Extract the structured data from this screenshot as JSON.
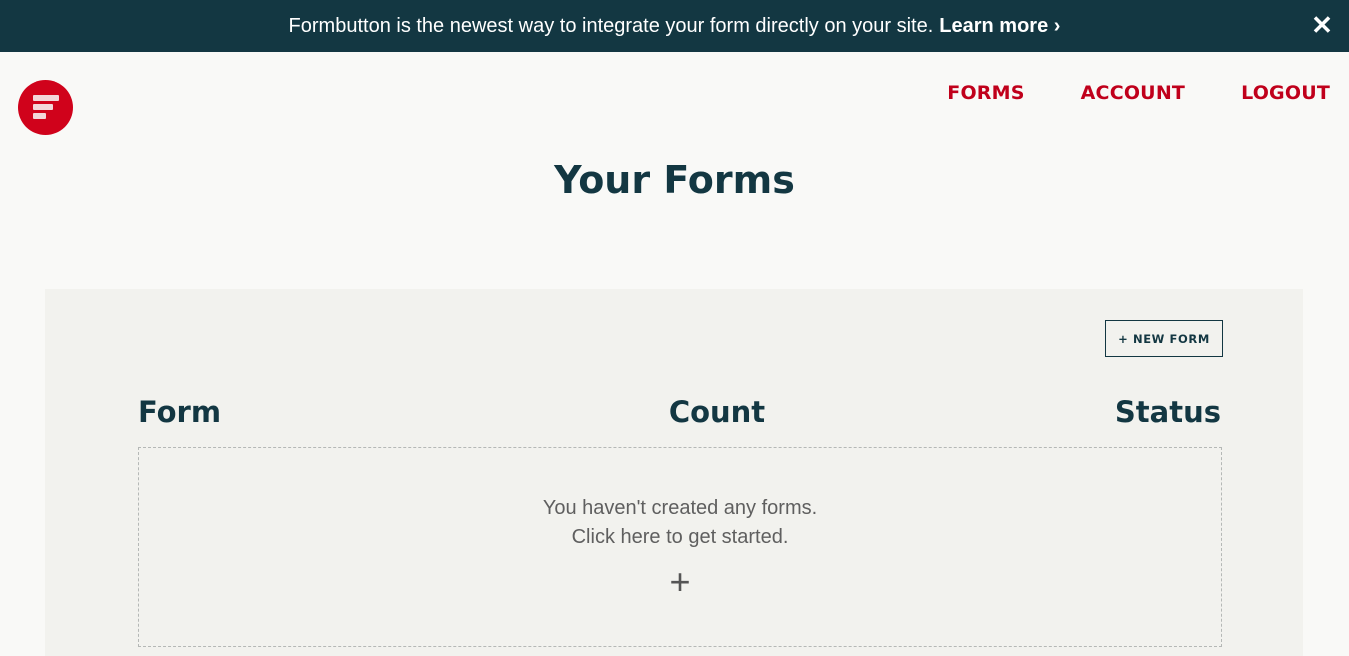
{
  "banner": {
    "message": "Formbutton is the newest way to integrate your form directly on your site.",
    "link_label": "Learn more ›",
    "close_glyph": "✕"
  },
  "nav": {
    "items": [
      {
        "label": "FORMS"
      },
      {
        "label": "ACCOUNT"
      },
      {
        "label": "LOGOUT"
      }
    ]
  },
  "page": {
    "title": "Your Forms"
  },
  "panel": {
    "new_form_label": "+ NEW FORM",
    "columns": [
      "Form",
      "Count",
      "Status"
    ],
    "empty_state": {
      "line1": "You haven't created any forms.",
      "line2": "Click here to get started.",
      "plus_glyph": "+"
    }
  },
  "colors": {
    "banner_bg": "#133742",
    "brand_red": "#d0021b",
    "nav_red": "#c0001b",
    "heading": "#133742",
    "panel_bg": "#f2f2ee"
  },
  "icons": {
    "logo": "formbutton-logo-icon",
    "close": "close-icon",
    "plus": "plus-icon"
  }
}
